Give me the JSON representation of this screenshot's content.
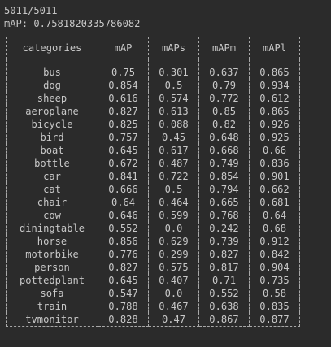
{
  "terminal": {
    "progress": "5011/5011",
    "map_line": "mAP: 0.7581820335786082"
  },
  "table": {
    "headers": [
      "categories",
      "mAP",
      "mAPs",
      "mAPm",
      "mAPl"
    ],
    "rows": [
      [
        "bus",
        "0.75",
        "0.301",
        "0.637",
        "0.865"
      ],
      [
        "dog",
        "0.854",
        "0.5",
        "0.79",
        "0.934"
      ],
      [
        "sheep",
        "0.616",
        "0.574",
        "0.772",
        "0.612"
      ],
      [
        "aeroplane",
        "0.827",
        "0.613",
        "0.85",
        "0.865"
      ],
      [
        "bicycle",
        "0.825",
        "0.088",
        "0.82",
        "0.926"
      ],
      [
        "bird",
        "0.757",
        "0.45",
        "0.648",
        "0.925"
      ],
      [
        "boat",
        "0.645",
        "0.617",
        "0.668",
        "0.66"
      ],
      [
        "bottle",
        "0.672",
        "0.487",
        "0.749",
        "0.836"
      ],
      [
        "car",
        "0.841",
        "0.722",
        "0.854",
        "0.901"
      ],
      [
        "cat",
        "0.666",
        "0.5",
        "0.794",
        "0.662"
      ],
      [
        "chair",
        "0.64",
        "0.464",
        "0.665",
        "0.681"
      ],
      [
        "cow",
        "0.646",
        "0.599",
        "0.768",
        "0.64"
      ],
      [
        "diningtable",
        "0.552",
        "0.0",
        "0.242",
        "0.68"
      ],
      [
        "horse",
        "0.856",
        "0.629",
        "0.739",
        "0.912"
      ],
      [
        "motorbike",
        "0.776",
        "0.299",
        "0.827",
        "0.842"
      ],
      [
        "person",
        "0.827",
        "0.575",
        "0.817",
        "0.904"
      ],
      [
        "pottedplant",
        "0.645",
        "0.407",
        "0.71",
        "0.735"
      ],
      [
        "sofa",
        "0.547",
        "0.0",
        "0.552",
        "0.58"
      ],
      [
        "train",
        "0.788",
        "0.467",
        "0.638",
        "0.835"
      ],
      [
        "tvmonitor",
        "0.828",
        "0.47",
        "0.867",
        "0.877"
      ]
    ]
  },
  "colors": {
    "background": "#2b2b2b",
    "text": "#c8c8c8",
    "border": "#a8a8a8"
  }
}
